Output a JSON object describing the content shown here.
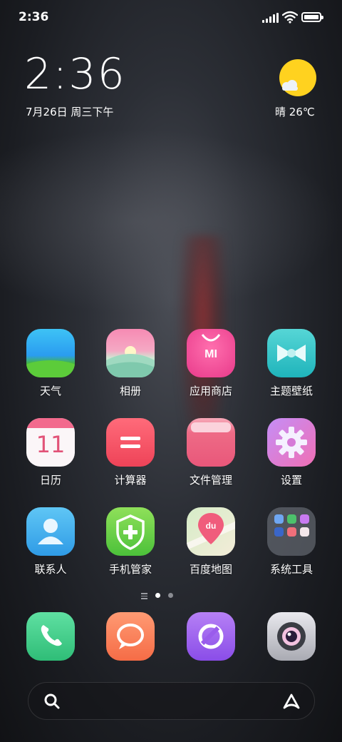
{
  "status_bar": {
    "time": "2:36"
  },
  "clock": {
    "time": "2:36",
    "date": "7月26日 周三下午"
  },
  "weather": {
    "condition": "晴",
    "temperature": "26℃",
    "icon": "sun-cloud-icon",
    "sun_color": "#FFD21F"
  },
  "apps": [
    {
      "label": "天气",
      "icon": "weather-app-icon"
    },
    {
      "label": "相册",
      "icon": "gallery-app-icon"
    },
    {
      "label": "应用商店",
      "icon": "app-store-icon",
      "badge": "MI"
    },
    {
      "label": "主题壁纸",
      "icon": "themes-bow-icon"
    },
    {
      "label": "日历",
      "icon": "calendar-app-icon",
      "day": "11"
    },
    {
      "label": "计算器",
      "icon": "calculator-app-icon"
    },
    {
      "label": "文件管理",
      "icon": "file-manager-icon"
    },
    {
      "label": "设置",
      "icon": "settings-gear-icon"
    },
    {
      "label": "联系人",
      "icon": "contacts-app-icon"
    },
    {
      "label": "手机管家",
      "icon": "security-shield-icon"
    },
    {
      "label": "百度地图",
      "icon": "baidu-map-icon",
      "badge": "du"
    },
    {
      "label": "系统工具",
      "icon": "system-tools-folder-icon"
    }
  ],
  "dock": [
    {
      "icon": "phone-icon"
    },
    {
      "icon": "messages-icon"
    },
    {
      "icon": "browser-icon"
    },
    {
      "icon": "camera-icon"
    }
  ],
  "page_indicator": {
    "pages": 2,
    "current": 1
  },
  "search": {
    "icon": "search-icon",
    "assistant_icon": "assistant-icon"
  }
}
